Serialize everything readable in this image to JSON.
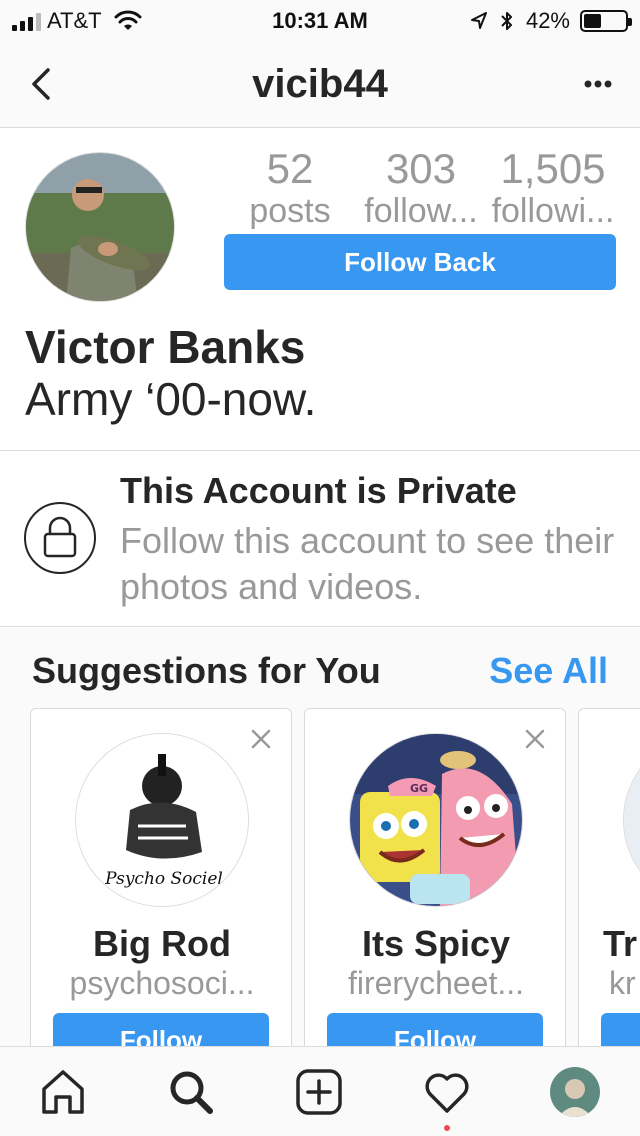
{
  "status_bar": {
    "carrier": "AT&T",
    "time": "10:31 AM",
    "battery_percent": "42%",
    "battery_level": 0.42,
    "icons": [
      "signal-icon",
      "wifi-icon",
      "location-icon",
      "bluetooth-icon",
      "battery-icon"
    ]
  },
  "nav": {
    "title": "vicib44",
    "back_icon": "chevron-left-icon",
    "more_icon": "more-horizontal-icon"
  },
  "profile": {
    "stats": [
      {
        "value": "52",
        "label": "posts"
      },
      {
        "value": "303",
        "label": "follow..."
      },
      {
        "value": "1,505",
        "label": "followi..."
      }
    ],
    "follow_back_label": "Follow Back",
    "full_name": "Victor Banks",
    "bio": "Army ‘00-now."
  },
  "private_notice": {
    "title": "This Account is Private",
    "text": "Follow this account to see their photos and videos.",
    "icon": "lock-icon"
  },
  "suggestions": {
    "title": "Suggestions for You",
    "see_all_label": "See All",
    "cards": [
      {
        "name": "Big Rod",
        "username": "psychosoci...",
        "follow_label": "Follow",
        "avatar_caption": "Psycho Sociel"
      },
      {
        "name": "Its Spicy",
        "username": "firerycheet...",
        "follow_label": "Follow",
        "avatar_caption": "GG"
      },
      {
        "name": "Tr",
        "username": "kr",
        "follow_label": ""
      }
    ]
  },
  "tab_bar": {
    "icons": [
      "home-icon",
      "search-icon",
      "add-post-icon",
      "heart-icon",
      "profile-avatar"
    ]
  },
  "colors": {
    "accent": "#3897f0",
    "text": "#262626",
    "muted": "#999999",
    "divider": "#dbdbdb",
    "notification": "#ed4956"
  }
}
